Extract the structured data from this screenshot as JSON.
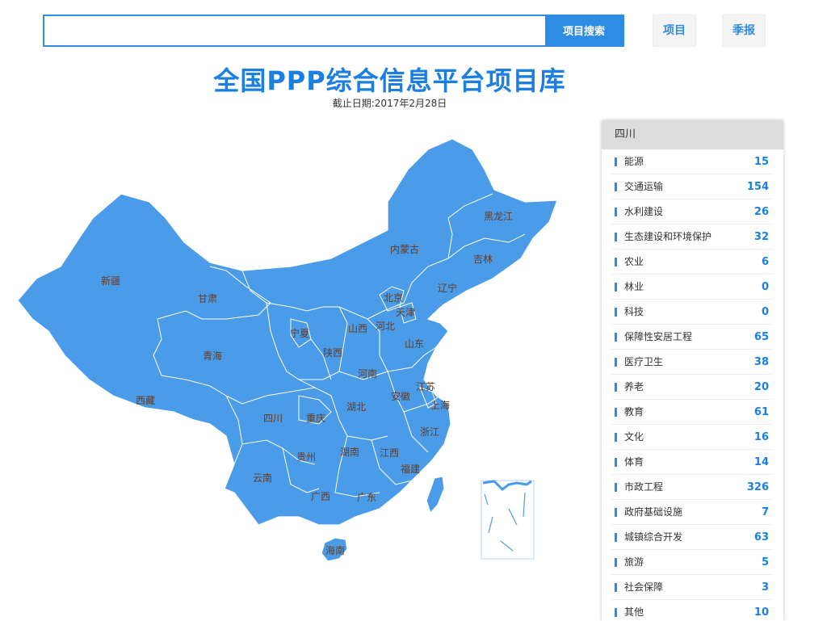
{
  "search": {
    "placeholder": "",
    "button_label": "项目搜索"
  },
  "nav": {
    "projects_label": "项目",
    "quarterly_label": "季报"
  },
  "header": {
    "title": "全国PPP综合信息平台项目库",
    "date_text": "截止日期:2017年2月28日"
  },
  "map": {
    "fill_color": "#4a9be8",
    "border_color": "#ffffff",
    "label_color": "#6b3a1f",
    "provinces": [
      "新疆",
      "西藏",
      "青海",
      "甘肃",
      "内蒙古",
      "黑龙江",
      "吉林",
      "辽宁",
      "北京",
      "天津",
      "河北",
      "山西",
      "宁夏",
      "陕西",
      "山东",
      "河南",
      "江苏",
      "安徽",
      "上海",
      "湖北",
      "四川",
      "重庆",
      "浙江",
      "湖南",
      "江西",
      "贵州",
      "云南",
      "广西",
      "广东",
      "福建",
      "海南"
    ]
  },
  "panel": {
    "region": "四川",
    "items": [
      {
        "label": "能源",
        "count": "15"
      },
      {
        "label": "交通运输",
        "count": "154"
      },
      {
        "label": "水利建设",
        "count": "26"
      },
      {
        "label": "生态建设和环境保护",
        "count": "32"
      },
      {
        "label": "农业",
        "count": "6"
      },
      {
        "label": "林业",
        "count": "0"
      },
      {
        "label": "科技",
        "count": "0"
      },
      {
        "label": "保障性安居工程",
        "count": "65"
      },
      {
        "label": "医疗卫生",
        "count": "38"
      },
      {
        "label": "养老",
        "count": "20"
      },
      {
        "label": "教育",
        "count": "61"
      },
      {
        "label": "文化",
        "count": "16"
      },
      {
        "label": "体育",
        "count": "14"
      },
      {
        "label": "市政工程",
        "count": "326"
      },
      {
        "label": "政府基础设施",
        "count": "7"
      },
      {
        "label": "城镇综合开发",
        "count": "63"
      },
      {
        "label": "旅游",
        "count": "5"
      },
      {
        "label": "社会保障",
        "count": "3"
      },
      {
        "label": "其他",
        "count": "10"
      }
    ]
  }
}
